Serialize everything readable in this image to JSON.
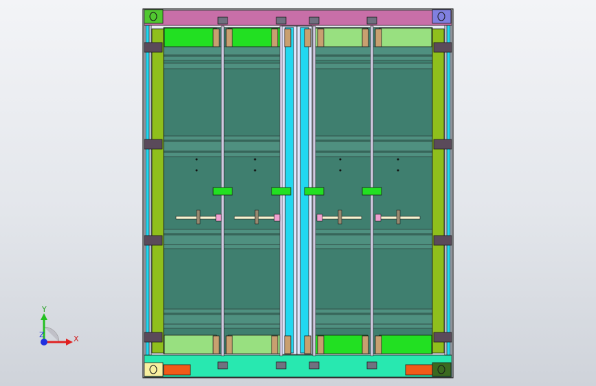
{
  "viewport": {
    "name": "cad-graphics-area",
    "background_top": "#f3f4f7",
    "background_bottom": "#cfd3da",
    "model": "container-door-assembly-front-view"
  },
  "colors": {
    "frame_outline": "#1a1a1a",
    "top_rail": "#c86fa8",
    "bottom_rail": "#28e8b0",
    "center_post": "#22d8f0",
    "side_post": "#8fbf1c",
    "door_panel": "#3f7f6f",
    "panel_band": "#4f9080",
    "green_bright": "#22e022",
    "green_light": "#98e080",
    "hinge": "#5a4a5a",
    "bracket_tan": "#c8a070",
    "corner_green": "#50c830",
    "corner_blue": "#8080e0",
    "corner_yellow": "#f8f0a0",
    "corner_dark": "#3a6a20",
    "orange_block": "#f05a18",
    "lock_bar": "#f8f4d0",
    "lock_pink": "#f0a0d0",
    "rod": "#d0c8e0"
  },
  "triad": {
    "x_label": "X",
    "y_label": "Y",
    "z_label": "Z",
    "x_color": "#e02020",
    "y_color": "#22c020",
    "z_color": "#2030e0"
  }
}
